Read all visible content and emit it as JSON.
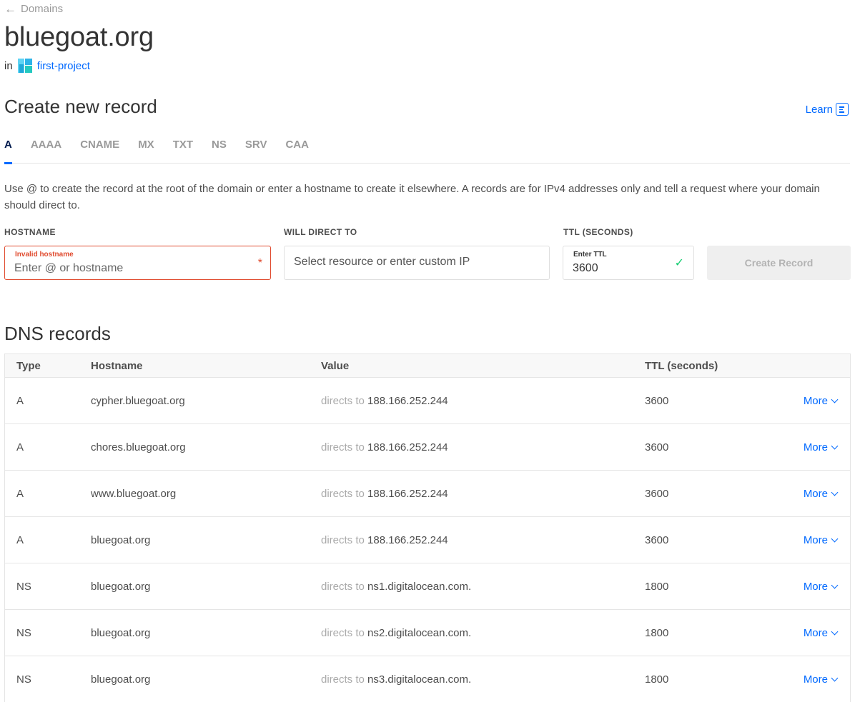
{
  "breadcrumb": {
    "label": "Domains"
  },
  "domain": {
    "title": "bluegoat.org",
    "in_label": "in",
    "project": "first-project"
  },
  "create": {
    "title": "Create new record",
    "learn_label": "Learn",
    "tabs": [
      "A",
      "AAAA",
      "CNAME",
      "MX",
      "TXT",
      "NS",
      "SRV",
      "CAA"
    ],
    "active_tab": "A",
    "help_text": "Use @ to create the record at the root of the domain or enter a hostname to create it elsewhere. A records are for IPv4 addresses only and tell a request where your domain should direct to.",
    "hostname": {
      "label": "HOSTNAME",
      "error": "Invalid hostname",
      "placeholder": "Enter @ or hostname",
      "required_mark": "*"
    },
    "direct": {
      "label": "WILL DIRECT TO",
      "placeholder": "Select resource or enter custom IP"
    },
    "ttl": {
      "label": "TTL (SECONDS)",
      "mini_label": "Enter TTL",
      "value": "3600"
    },
    "submit_label": "Create Record"
  },
  "dns": {
    "title": "DNS records",
    "headers": {
      "type": "Type",
      "hostname": "Hostname",
      "value": "Value",
      "ttl": "TTL (seconds)"
    },
    "directs_label": "directs to",
    "more_label": "More",
    "records": [
      {
        "type": "A",
        "hostname": "cypher.bluegoat.org",
        "value": "188.166.252.244",
        "ttl": "3600"
      },
      {
        "type": "A",
        "hostname": "chores.bluegoat.org",
        "value": "188.166.252.244",
        "ttl": "3600"
      },
      {
        "type": "A",
        "hostname": "www.bluegoat.org",
        "value": "188.166.252.244",
        "ttl": "3600"
      },
      {
        "type": "A",
        "hostname": "bluegoat.org",
        "value": "188.166.252.244",
        "ttl": "3600"
      },
      {
        "type": "NS",
        "hostname": "bluegoat.org",
        "value": "ns1.digitalocean.com.",
        "ttl": "1800"
      },
      {
        "type": "NS",
        "hostname": "bluegoat.org",
        "value": "ns2.digitalocean.com.",
        "ttl": "1800"
      },
      {
        "type": "NS",
        "hostname": "bluegoat.org",
        "value": "ns3.digitalocean.com.",
        "ttl": "1800"
      }
    ]
  },
  "colors": {
    "accent": "#0069ff",
    "error": "#e04b2f",
    "success": "#15cd72"
  }
}
